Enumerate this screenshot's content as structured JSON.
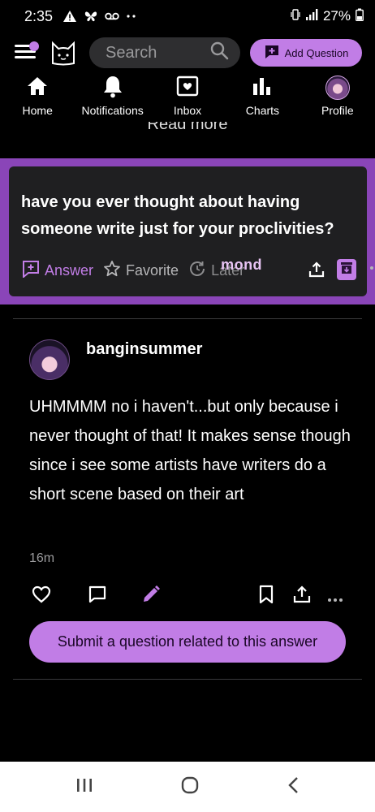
{
  "status_bar": {
    "time": "2:35",
    "battery": "27%",
    "icons": [
      "alert-icon",
      "butterfly-icon",
      "voicemail-icon",
      "dots-icon",
      "vibrate-icon",
      "signal-icon",
      "battery-icon"
    ]
  },
  "header": {
    "search_placeholder": "Search",
    "add_question_label": "Add Question",
    "accent_color": "#c17de6"
  },
  "tabs": [
    {
      "label": "Home",
      "icon": "home-icon"
    },
    {
      "label": "Notifications",
      "icon": "bell-icon"
    },
    {
      "label": "Inbox",
      "icon": "inbox-icon"
    },
    {
      "label": "Charts",
      "icon": "bar-chart-icon"
    },
    {
      "label": "Profile",
      "icon": "profile-avatar"
    }
  ],
  "read_more": "Read more",
  "question": {
    "text": "have you ever thought about having someone write just for your proclivities?",
    "actions": {
      "answer": "Answer",
      "favorite": "Favorite",
      "later": "Later",
      "overlay": "mond"
    },
    "band_color": "#8a45b8"
  },
  "answer": {
    "author": "banginsummer",
    "body": "UHMMMM no i haven't...but only because i never thought of that!  It makes sense though since i see some artists have writers do a short scene based on their art",
    "timestamp": "16m",
    "submit_related_label": "Submit a question related to this answer"
  },
  "system_nav": {
    "icons": [
      "recents-icon",
      "home-circle-icon",
      "back-icon"
    ]
  }
}
